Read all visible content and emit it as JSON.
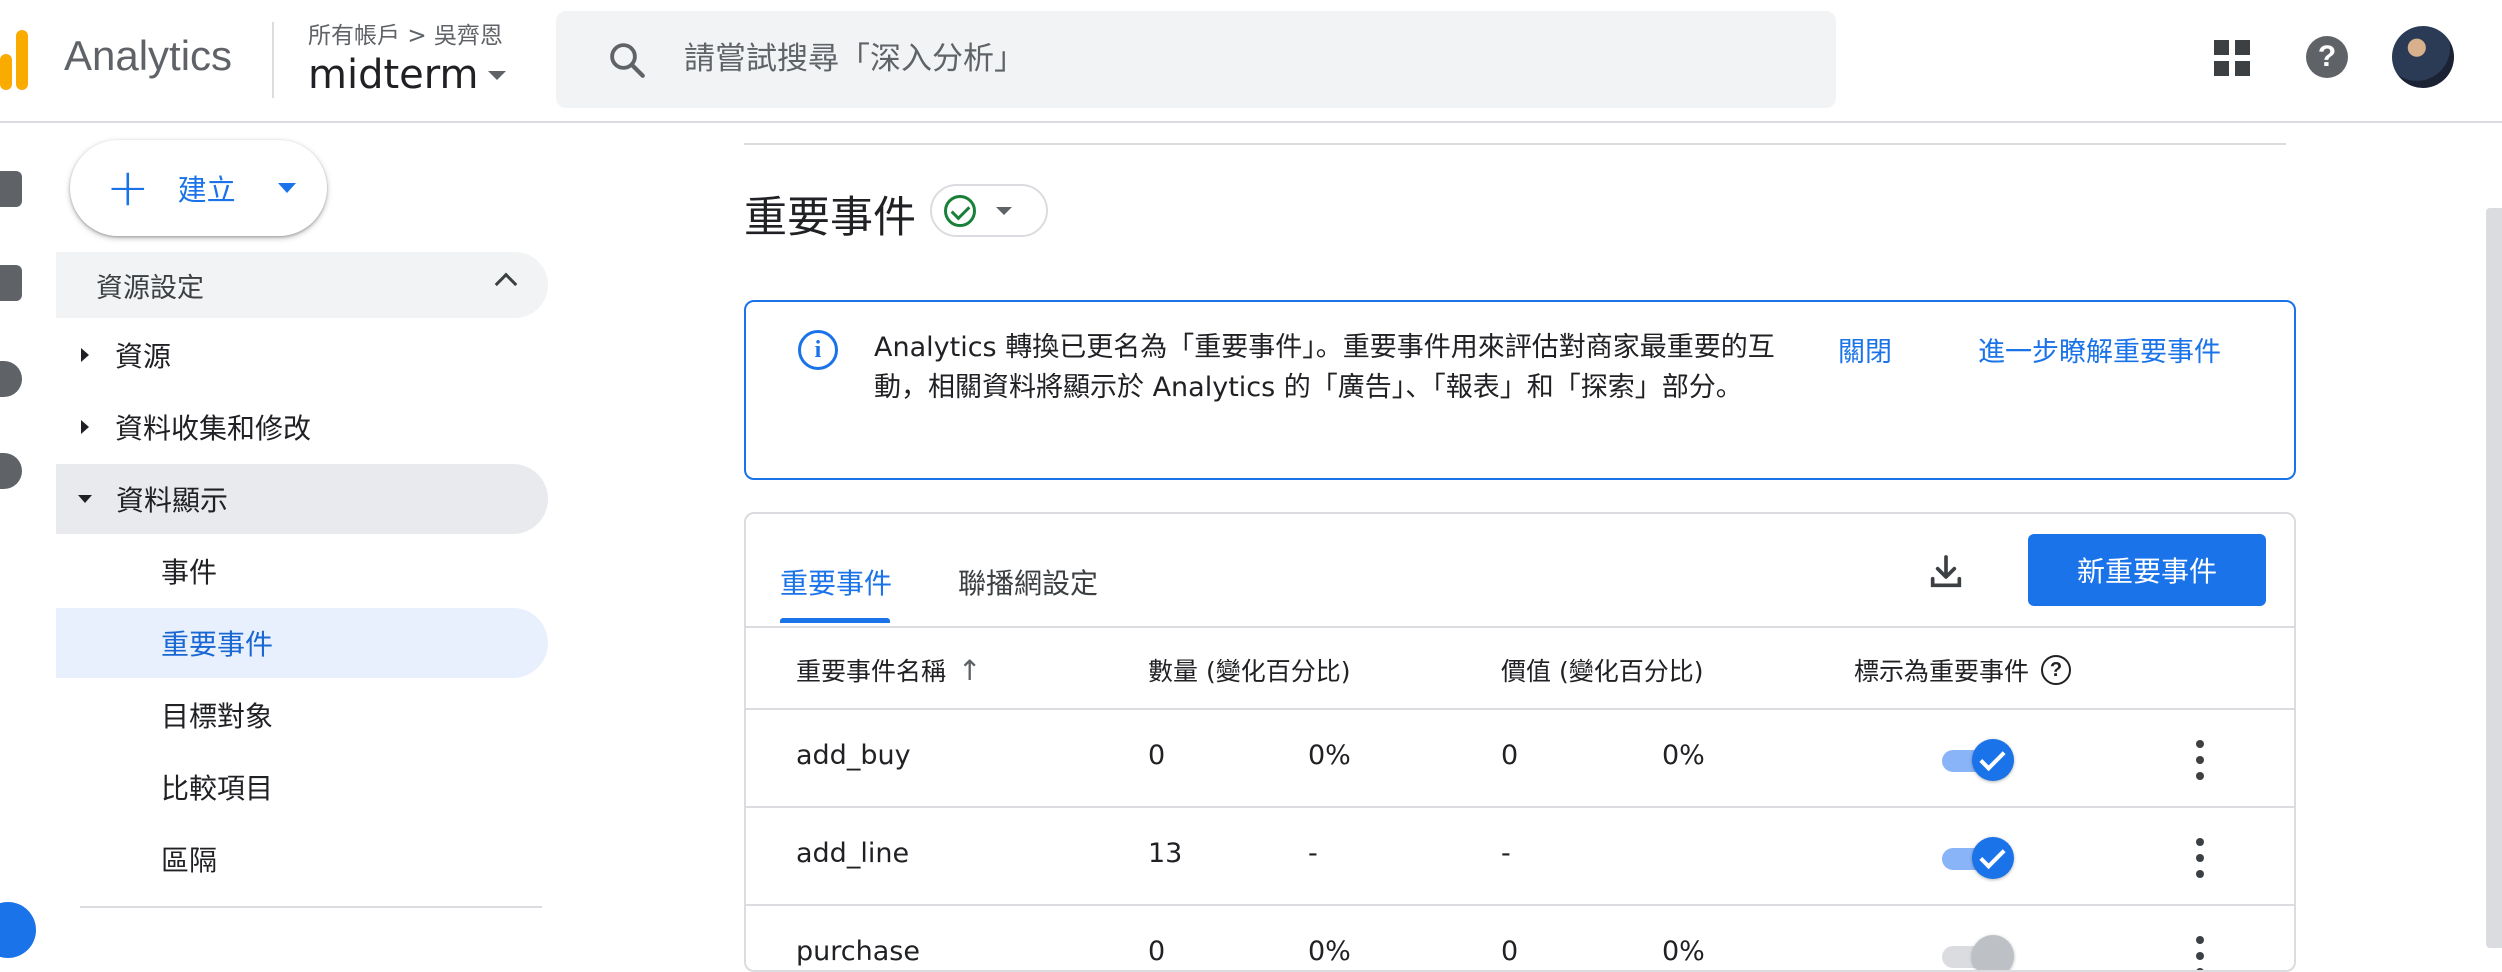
{
  "header": {
    "app_title": "Analytics",
    "breadcrumb_root": "所有帳戶",
    "breadcrumb_sep": ">",
    "breadcrumb_account": "吳齊恩",
    "property": "midterm",
    "search_placeholder": "請嘗試搜尋「深入分析」"
  },
  "sidebar": {
    "create_label": "建立",
    "section_title": "資源設定",
    "items": [
      {
        "label": "資源"
      },
      {
        "label": "資料收集和修改"
      },
      {
        "label": "資料顯示"
      }
    ],
    "sub_items": [
      {
        "label": "事件"
      },
      {
        "label": "重要事件"
      },
      {
        "label": "目標對象"
      },
      {
        "label": "比較項目"
      },
      {
        "label": "區隔"
      }
    ]
  },
  "main": {
    "title": "重要事件",
    "banner": {
      "text": "Analytics 轉換已更名為「重要事件」。重要事件用來評估對商家最重要的互動，相關資料將顯示於 Analytics 的「廣告」、「報表」和「探索」部分。",
      "dismiss": "關閉",
      "learn_more": "進一步瞭解重要事件"
    },
    "tabs": [
      {
        "label": "重要事件"
      },
      {
        "label": "聯播網設定"
      }
    ],
    "new_button": "新重要事件",
    "columns": {
      "name": "重要事件名稱",
      "count": "數量 (變化百分比)",
      "value": "價值 (變化百分比)",
      "mark": "標示為重要事件",
      "help": "?"
    },
    "rows": [
      {
        "name": "add_buy",
        "count": "0",
        "count_change": "0%",
        "value": "0",
        "value_change": "0%",
        "marked": true
      },
      {
        "name": "add_line",
        "count": "13",
        "count_change": "-",
        "value": "-",
        "value_change": "",
        "marked": true
      },
      {
        "name": "purchase",
        "count": "0",
        "count_change": "0%",
        "value": "0",
        "value_change": "0%",
        "marked": false
      }
    ]
  },
  "colors": {
    "accent": "#1a73e8",
    "brand": "#f9ab00",
    "success": "#188038"
  }
}
